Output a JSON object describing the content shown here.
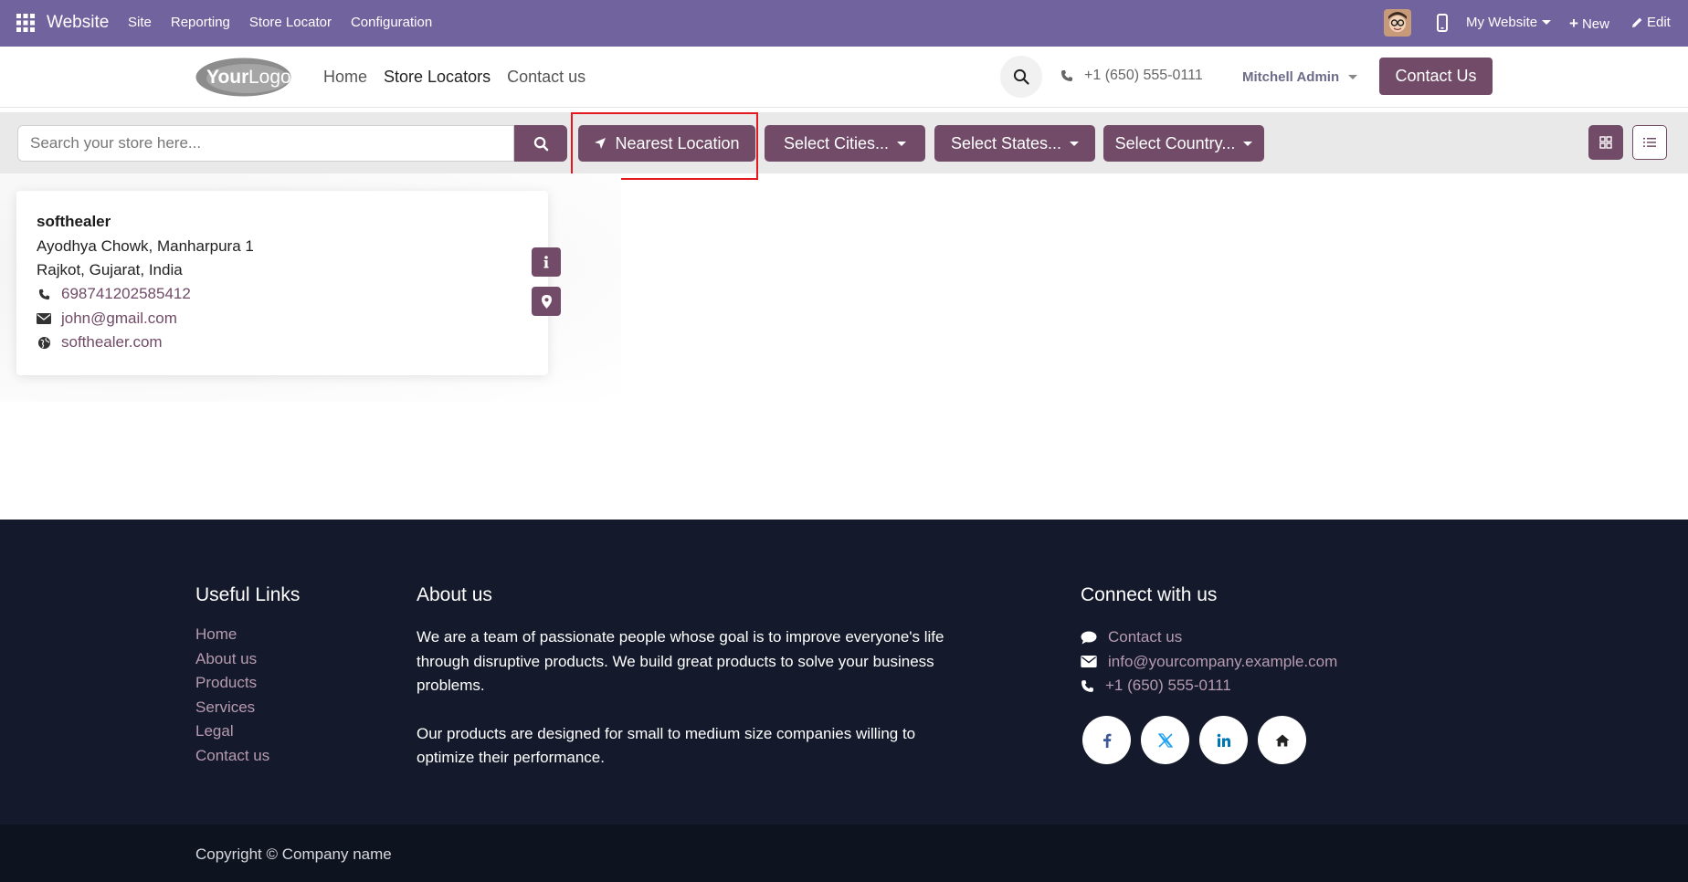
{
  "topbar": {
    "brand": "Website",
    "menu": [
      "Site",
      "Reporting",
      "Store Locator",
      "Configuration"
    ],
    "my_website": "My Website",
    "new_label": "New",
    "edit_label": "Edit",
    "bg_color": "#71639e"
  },
  "header": {
    "logo_text": "YourLogo",
    "nav": [
      "Home",
      "Store Locators",
      "Contact us"
    ],
    "active_nav": "Store Locators",
    "phone": "+1 (650) 555-0111",
    "user": "Mitchell Admin",
    "contact_button": "Contact Us",
    "accent_color": "#714b67"
  },
  "filters": {
    "search_placeholder": "Search your store here...",
    "nearest_location": "Nearest Location",
    "select_cities": "Select Cities...",
    "select_states": "Select States...",
    "select_country": "Select Country..."
  },
  "store": {
    "name": "softhealer",
    "address_line1": "Ayodhya Chowk, Manharpura 1",
    "address_line2": "Rajkot, Gujarat, India",
    "phone": "698741202585412",
    "email": "john@gmail.com",
    "website": "softhealer.com"
  },
  "footer": {
    "useful_links_title": "Useful Links",
    "useful_links": [
      "Home",
      "About us",
      "Products",
      "Services",
      "Legal",
      "Contact us"
    ],
    "about_title": "About us",
    "about_p1": "We are a team of passionate people whose goal is to improve everyone's life through disruptive products. We build great products to solve your business problems.",
    "about_p2": "Our products are designed for small to medium size companies willing to optimize their performance.",
    "connect_title": "Connect with us",
    "connect_contact": "Contact us",
    "connect_email": "info@yourcompany.example.com",
    "connect_phone": "+1 (650) 555-0111",
    "social_icons": [
      "facebook-icon",
      "x-twitter-icon",
      "linkedin-icon",
      "home-icon"
    ],
    "copyright": "Copyright © Company name"
  }
}
